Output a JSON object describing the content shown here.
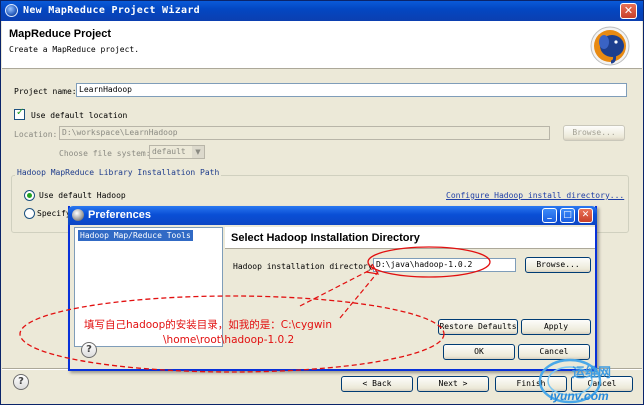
{
  "wizard": {
    "title": "New MapReduce Project Wizard",
    "header_title": "MapReduce Project",
    "header_description": "Create a MapReduce project.",
    "project_name_label": "Project name:",
    "project_name_value": "LearnHadoop",
    "use_default_location_label": "Use default location",
    "location_label": "Location:",
    "location_value": "D:\\workspace\\LearnHadoop",
    "browse_label": "Browse...",
    "file_system_label": "Choose file system:",
    "file_system_value": "default",
    "group_title": "Hadoop MapReduce Library Installation Path",
    "use_default_hadoop_label": "Use default Hadoop",
    "configure_link": "Configure Hadoop install directory...",
    "specify_label": "Specify",
    "back_label": "< Back",
    "next_label": "Next >",
    "finish_label": "Finish",
    "cancel_label": "Cancel"
  },
  "preferences": {
    "title": "Preferences",
    "tree_item": "Hadoop Map/Reduce Tools",
    "page_title": "Select Hadoop Installation Directory",
    "dir_label": "Hadoop installation directory:",
    "dir_value": "D:\\java\\hadoop-1.0.2",
    "browse_label": "Browse...",
    "restore_defaults_label": "Restore Defaults",
    "apply_label": "Apply",
    "ok_label": "OK",
    "cancel_label": "Cancel"
  },
  "annotation": {
    "line1": "填写自己hadoop的安装目录，如我的是：C:\\cygwin",
    "line2": "\\home\\root\\hadoop-1.0.2"
  },
  "watermark": {
    "text1": "运维网",
    "text2": "iyunv.com"
  },
  "colors": {
    "titlebar": "#0a4fd6",
    "window_bg": "#ece9d8",
    "annotation": "#e21010",
    "link": "#1f3fa6"
  }
}
